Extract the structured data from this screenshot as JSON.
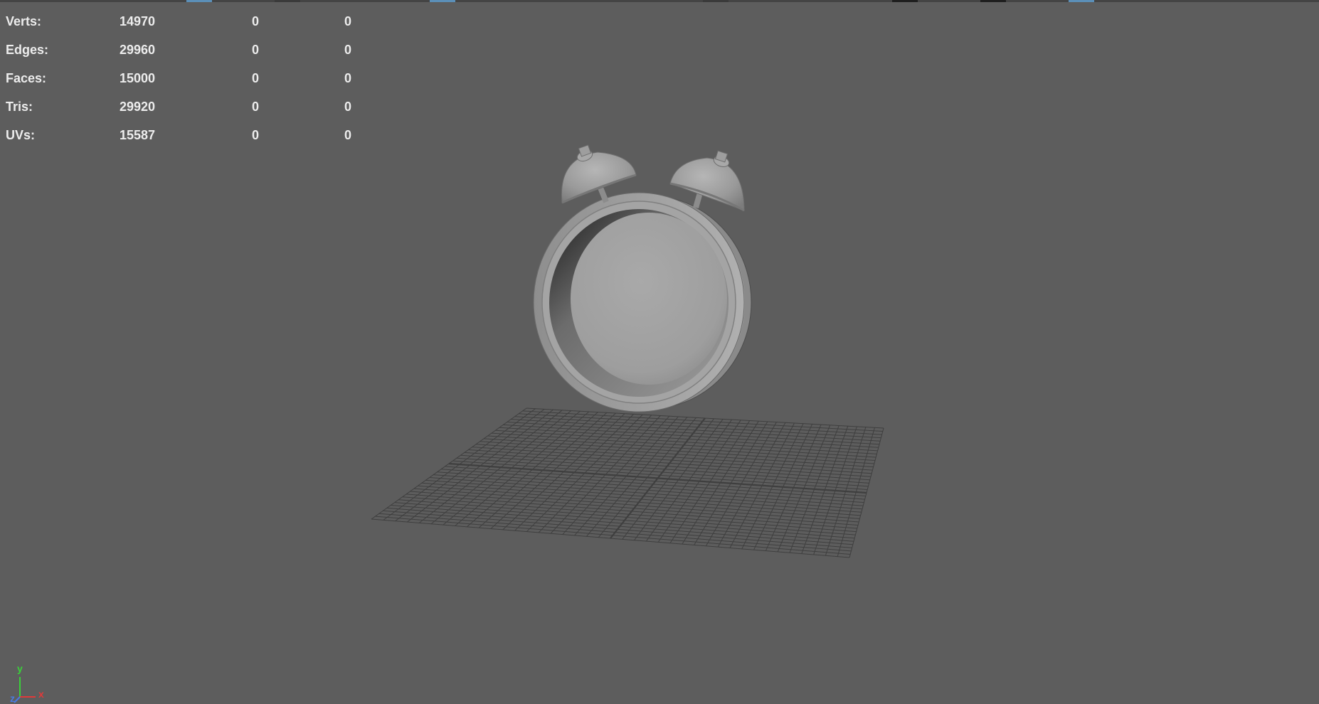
{
  "hud": {
    "rows": [
      {
        "label": "Verts:",
        "v1": "14970",
        "v2": "0",
        "v3": "0"
      },
      {
        "label": "Edges:",
        "v1": "29960",
        "v2": "0",
        "v3": "0"
      },
      {
        "label": "Faces:",
        "v1": "15000",
        "v2": "0",
        "v3": "0"
      },
      {
        "label": "Tris:",
        "v1": "29920",
        "v2": "0",
        "v3": "0"
      },
      {
        "label": "UVs:",
        "v1": "15587",
        "v2": "0",
        "v3": "0"
      }
    ]
  },
  "axis": {
    "y": "y",
    "x": "x",
    "z": "z"
  },
  "colors": {
    "viewport_bg": "#5d5d5d",
    "hud_text": "#ededed",
    "grid_line": "#3f3f3f",
    "model_mid": "#9a9a9a",
    "axis_x": "#e03a3a",
    "axis_y": "#3ad03a",
    "axis_z": "#4a7ae0",
    "tab_accent": "#5b8fb8"
  }
}
